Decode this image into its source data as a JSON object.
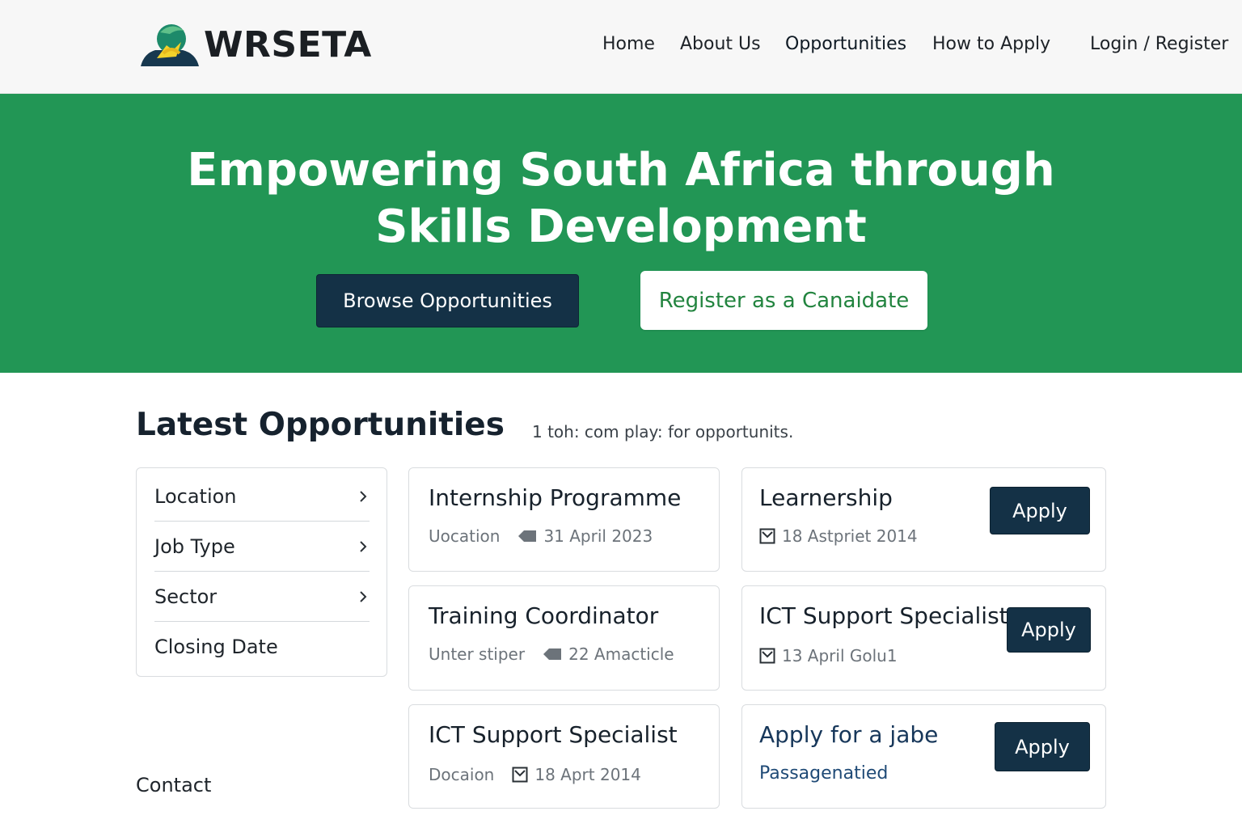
{
  "brand": {
    "name": "WRSETA"
  },
  "nav": {
    "items": [
      "Home",
      "About Us",
      "Opportunities",
      "How to Apply"
    ],
    "login": "Login / Register"
  },
  "hero": {
    "title_line1": "Empowering South Africa through",
    "title_line2": "Skills Development",
    "browse_label": "Browse Opportunities",
    "register_label": "Register as a Canaidate"
  },
  "colors": {
    "hero_green": "#229655",
    "navy_button": "#143146",
    "register_text": "#22843f"
  },
  "section": {
    "title": "Latest Opportunities",
    "subtitle": "1 toh: com play: for opportunits."
  },
  "filters": [
    {
      "label": "Location",
      "icon": "chevron-right-icon"
    },
    {
      "label": "Job Type",
      "icon": "chevron-right-icon"
    },
    {
      "label": "Sector",
      "icon": "chevron-right-icon"
    },
    {
      "label": "Closing Date"
    }
  ],
  "cards": [
    {
      "title": "Internship Programme",
      "label": "Uocation",
      "icon": "tag-icon",
      "date": "31 April 2023"
    },
    {
      "title": "Learnership",
      "icon": "checkbox-icon",
      "date": "18 Astpriet 2014",
      "apply": "Apply"
    },
    {
      "title": "Training Coordinator",
      "label": "Unter stiper",
      "icon": "tag-icon",
      "date": "22 Amacticle"
    },
    {
      "title": "ICT Support Specialist",
      "icon": "checkbox-icon",
      "date": "13 April Golu1",
      "apply": "Apply"
    },
    {
      "title": "ICT Support Specialist",
      "label": "Docaion",
      "icon": "checkbox-icon",
      "date": "18 Aprt 2014"
    },
    {
      "title": "Apply for a jabe",
      "link": "Passagenatied",
      "apply": "Apply"
    }
  ],
  "footer": {
    "contact": "Contact"
  }
}
